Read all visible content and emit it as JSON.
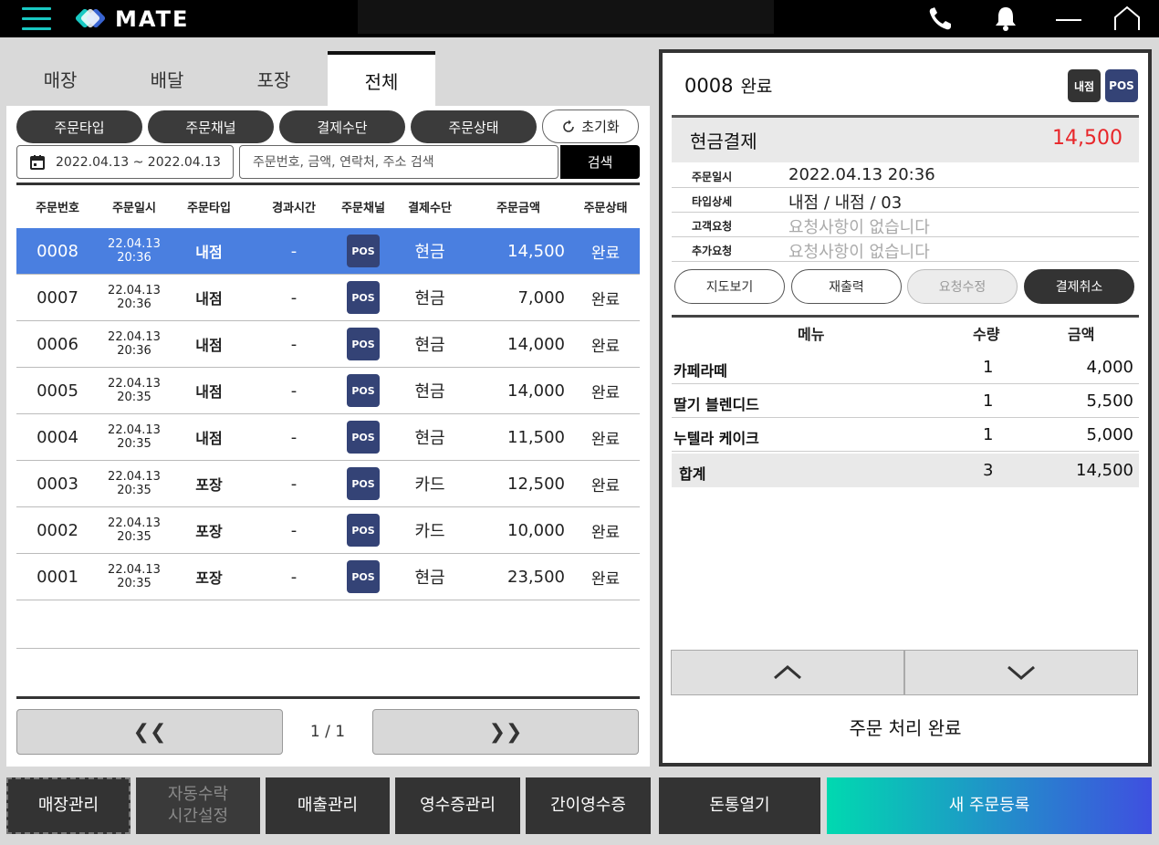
{
  "brand": {
    "name": "MATE"
  },
  "colors": {
    "accent": "#19c9c3",
    "selected_row": "#4a7fe0",
    "pos_badge": "#344376",
    "amount_red": "#e8262a",
    "gradient_start": "#00d9b0",
    "gradient_end": "#3f4fe0"
  },
  "tabs": [
    {
      "label": "매장"
    },
    {
      "label": "배달"
    },
    {
      "label": "포장"
    },
    {
      "label": "전체",
      "active": true
    }
  ],
  "filters": {
    "order_type": "주문타입",
    "order_channel": "주문채널",
    "payment_method": "결제수단",
    "order_status": "주문상태",
    "reset": "초기화",
    "date_range": "2022.04.13 ~ 2022.04.13",
    "search_placeholder": "주문번호, 금액, 연락처, 주소 검색",
    "search_button": "검색"
  },
  "table": {
    "columns": [
      "주문번호",
      "주문일시",
      "주문타입",
      "경과시간",
      "주문채널",
      "결제수단",
      "주문금액",
      "주문상태"
    ],
    "rows": [
      {
        "no": "0008",
        "date": "22.04.13",
        "time": "20:36",
        "type": "내점",
        "elapsed": "-",
        "channel": "POS",
        "payment": "현금",
        "amount": "14,500",
        "status": "완료",
        "selected": true
      },
      {
        "no": "0007",
        "date": "22.04.13",
        "time": "20:36",
        "type": "내점",
        "elapsed": "-",
        "channel": "POS",
        "payment": "현금",
        "amount": "7,000",
        "status": "완료"
      },
      {
        "no": "0006",
        "date": "22.04.13",
        "time": "20:36",
        "type": "내점",
        "elapsed": "-",
        "channel": "POS",
        "payment": "현금",
        "amount": "14,000",
        "status": "완료"
      },
      {
        "no": "0005",
        "date": "22.04.13",
        "time": "20:35",
        "type": "내점",
        "elapsed": "-",
        "channel": "POS",
        "payment": "현금",
        "amount": "14,000",
        "status": "완료"
      },
      {
        "no": "0004",
        "date": "22.04.13",
        "time": "20:35",
        "type": "내점",
        "elapsed": "-",
        "channel": "POS",
        "payment": "현금",
        "amount": "11,500",
        "status": "완료"
      },
      {
        "no": "0003",
        "date": "22.04.13",
        "time": "20:35",
        "type": "포장",
        "elapsed": "-",
        "channel": "POS",
        "payment": "카드",
        "amount": "12,500",
        "status": "완료"
      },
      {
        "no": "0002",
        "date": "22.04.13",
        "time": "20:35",
        "type": "포장",
        "elapsed": "-",
        "channel": "POS",
        "payment": "카드",
        "amount": "10,000",
        "status": "완료"
      },
      {
        "no": "0001",
        "date": "22.04.13",
        "time": "20:35",
        "type": "포장",
        "elapsed": "-",
        "channel": "POS",
        "payment": "현금",
        "amount": "23,500",
        "status": "완료"
      }
    ]
  },
  "pager": {
    "prev": "❮❮",
    "text": "1 / 1",
    "next": "❯❯"
  },
  "detail": {
    "order_no": "0008",
    "status": "완료",
    "badge_type": "내점",
    "badge_channel": "POS",
    "pay_label": "현금결제",
    "pay_amount": "14,500",
    "info": [
      {
        "key": "주문일시",
        "value": "2022.04.13 20:36",
        "muted": false
      },
      {
        "key": "타입상세",
        "value": "내점 / 내점 / 03",
        "muted": false
      },
      {
        "key": "고객요청",
        "value": "요청사항이 없습니다",
        "muted": true
      },
      {
        "key": "추가요청",
        "value": "요청사항이 없습니다",
        "muted": true
      }
    ],
    "actions": {
      "map": "지도보기",
      "reprint": "재출력",
      "edit_request": "요청수정",
      "cancel_payment": "결제취소"
    },
    "menu_head": {
      "menu": "메뉴",
      "qty": "수량",
      "price": "금액"
    },
    "menu_items": [
      {
        "name": "카페라떼",
        "qty": "1",
        "price": "4,000"
      },
      {
        "name": "딸기 블렌디드",
        "qty": "1",
        "price": "5,500"
      },
      {
        "name": "누텔라 케이크",
        "qty": "1",
        "price": "5,000"
      }
    ],
    "total": {
      "name": "합계",
      "qty": "3",
      "price": "14,500"
    },
    "complete_text": "주문 처리 완료"
  },
  "bottom": {
    "store_manage": "매장관리",
    "auto_accept_line1": "자동수락",
    "auto_accept_line2": "시간설정",
    "sales_manage": "매출관리",
    "receipt_manage": "영수증관리",
    "simple_receipt": "간이영수증",
    "open_drawer": "돈통열기",
    "new_order": "새 주문등록"
  }
}
